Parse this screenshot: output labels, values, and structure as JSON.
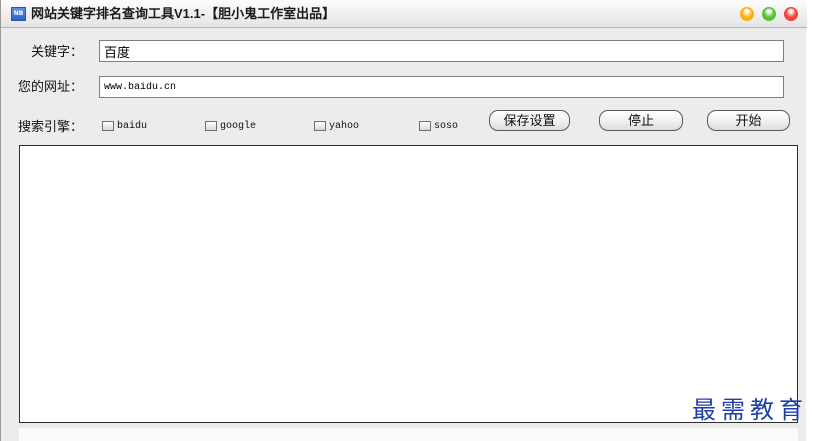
{
  "window": {
    "title": "网站关键字排名查询工具V1.1-【胆小鬼工作室出品】",
    "app_icon_text": "NB",
    "controls": [
      {
        "name": "minimize-icon",
        "color": "#f2b01e"
      },
      {
        "name": "maximize-icon",
        "color": "#5cbf3f"
      },
      {
        "name": "close-icon",
        "color": "#e5453a"
      }
    ]
  },
  "form": {
    "keyword": {
      "label": "关键字：",
      "value": "百度"
    },
    "url": {
      "label": "您的网址：",
      "value": "www.baidu.cn"
    },
    "engines": {
      "label": "搜索引擎：",
      "options": [
        {
          "label": "baidu",
          "checked": false
        },
        {
          "label": "google",
          "checked": false
        },
        {
          "label": "yahoo",
          "checked": false
        },
        {
          "label": "soso",
          "checked": false
        }
      ]
    }
  },
  "buttons": {
    "save": "保存设置",
    "stop": "停止",
    "start": "开始"
  },
  "results": {
    "value": ""
  },
  "watermark": {
    "text": "最需教育",
    "color": "#1f3fa8"
  }
}
